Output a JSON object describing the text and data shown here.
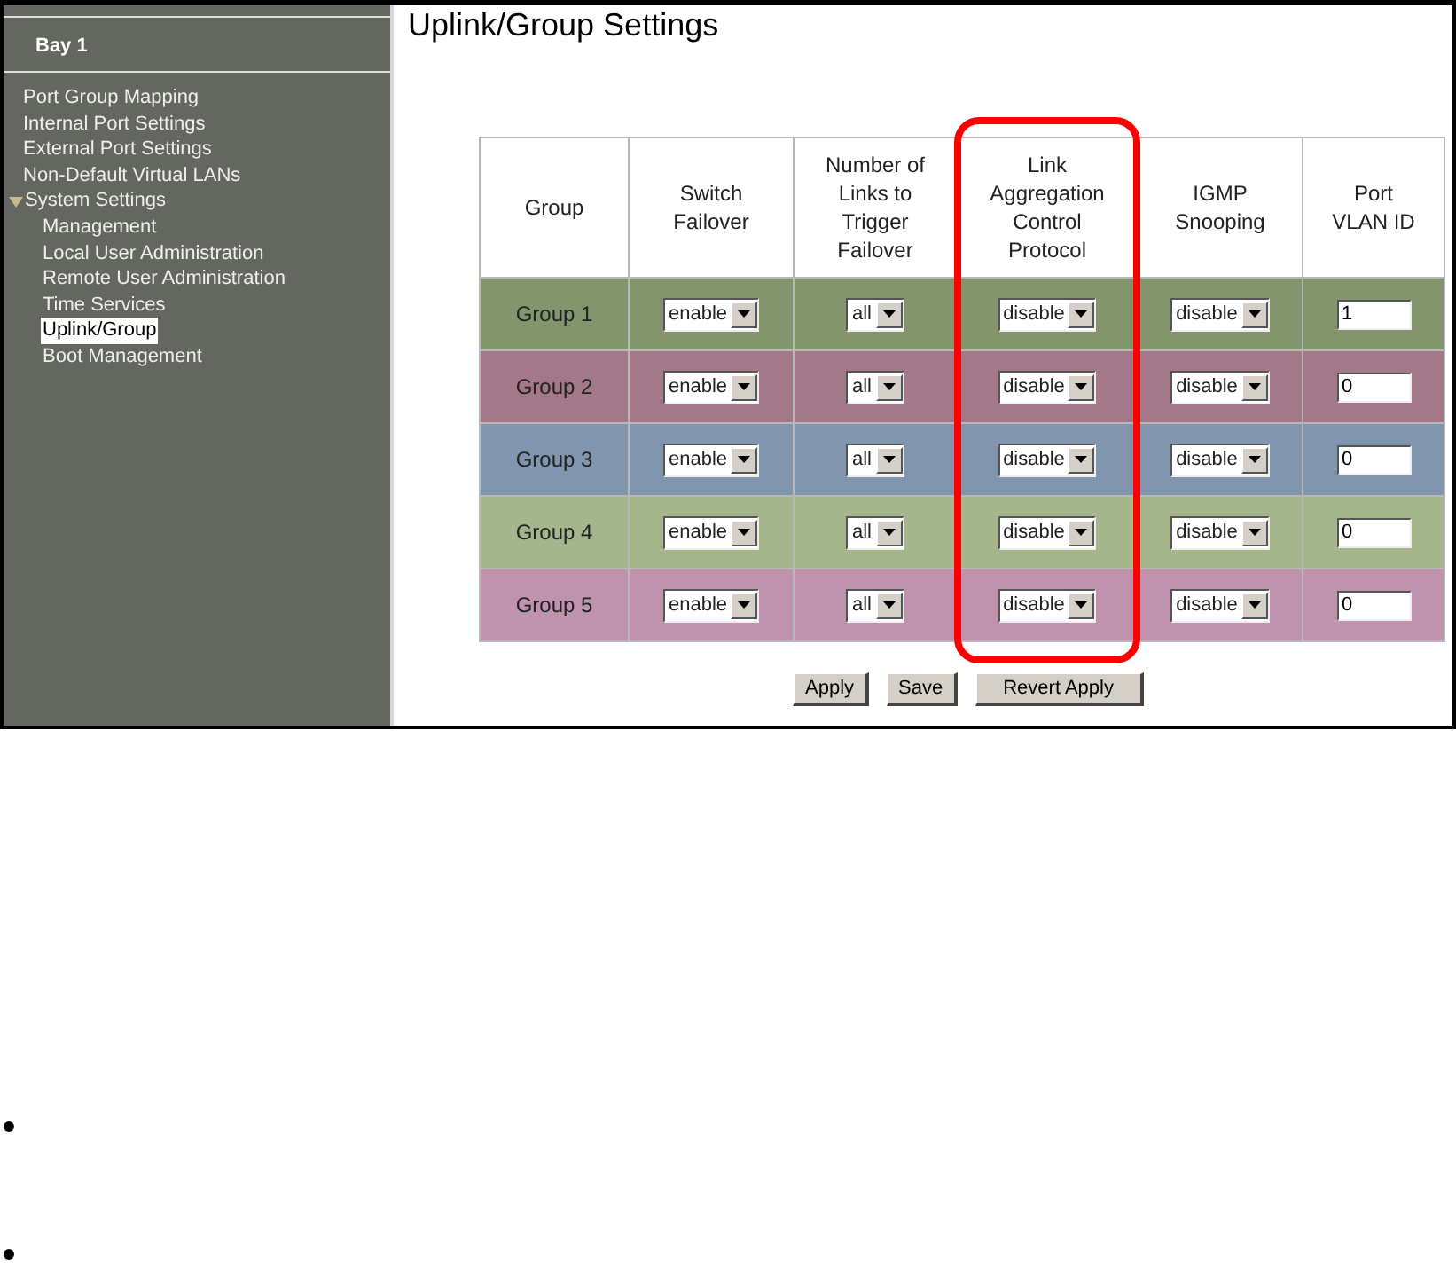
{
  "sidebar": {
    "title": "Bay 1",
    "items": [
      {
        "label": "Port Group Mapping",
        "selected": false
      },
      {
        "label": "Internal Port Settings",
        "selected": false
      },
      {
        "label": "External Port Settings",
        "selected": false
      },
      {
        "label": "Non-Default Virtual LANs",
        "selected": false
      },
      {
        "label": "System Settings",
        "selected": false,
        "expanded": true,
        "children": [
          {
            "label": "Management",
            "selected": false
          },
          {
            "label": "Local User Administration",
            "selected": false
          },
          {
            "label": "Remote User Administration",
            "selected": false
          },
          {
            "label": "Time Services",
            "selected": false
          },
          {
            "label": "Uplink/Group",
            "selected": true
          },
          {
            "label": "Boot Management",
            "selected": false
          }
        ]
      }
    ]
  },
  "page_title": "Uplink/Group Settings",
  "table": {
    "columns": [
      {
        "label": "Group",
        "highlighted": false
      },
      {
        "label": "Switch Failover",
        "highlighted": false
      },
      {
        "label": "Number of Links to Trigger Failover",
        "highlighted": false
      },
      {
        "label": "Link Aggregation Control Protocol",
        "highlighted": true
      },
      {
        "label": "IGMP Snooping",
        "highlighted": false
      },
      {
        "label": "Port VLAN ID",
        "highlighted": false
      }
    ],
    "rows": [
      {
        "group": "Group 1",
        "color": "#83956d",
        "switch_failover": "enable",
        "links": "all",
        "lacp": "disable",
        "igmp": "disable",
        "vlan_id": "1"
      },
      {
        "group": "Group 2",
        "color": "#a37888",
        "switch_failover": "enable",
        "links": "all",
        "lacp": "disable",
        "igmp": "disable",
        "vlan_id": "0"
      },
      {
        "group": "Group 3",
        "color": "#8196ae",
        "switch_failover": "enable",
        "links": "all",
        "lacp": "disable",
        "igmp": "disable",
        "vlan_id": "0"
      },
      {
        "group": "Group 4",
        "color": "#a5b68d",
        "switch_failover": "enable",
        "links": "all",
        "lacp": "disable",
        "igmp": "disable",
        "vlan_id": "0"
      },
      {
        "group": "Group 5",
        "color": "#bf93ad",
        "switch_failover": "enable",
        "links": "all",
        "lacp": "disable",
        "igmp": "disable",
        "vlan_id": "0"
      }
    ]
  },
  "buttons": [
    "Apply",
    "Save",
    "Revert Apply"
  ]
}
